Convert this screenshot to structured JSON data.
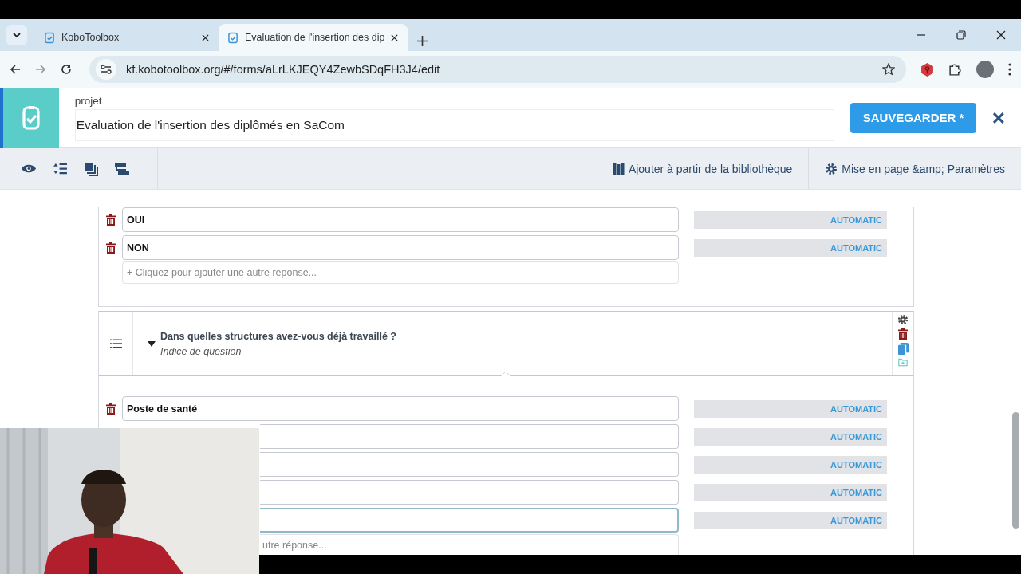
{
  "browser": {
    "tabs": [
      {
        "title": "KoboToolbox",
        "selected": false
      },
      {
        "title": "Evaluation de l'insertion des dip",
        "selected": true
      }
    ],
    "url": "kf.kobotoolbox.org/#/forms/aLrLKJEQY4ZewbSDqFH3J4/edit"
  },
  "header": {
    "label": "projet",
    "title": "Evaluation de l'insertion des diplômés en SaCom",
    "save_button": "SAUVEGARDER *"
  },
  "toolbar": {
    "library_button": "Ajouter à partir de la bibliothèque",
    "settings_button": "Mise en page &amp; Paramètres"
  },
  "questions": [
    {
      "options": [
        {
          "label": "OUI",
          "value": "AUTOMATIC",
          "focused": false
        },
        {
          "label": "NON",
          "value": "AUTOMATIC",
          "focused": false
        }
      ],
      "add_option": "+ Cliquez pour ajouter une autre réponse..."
    },
    {
      "title": "Dans quelles structures avez-vous déjà travaillé ?",
      "hint": "Indice de question",
      "expanded": true,
      "options": [
        {
          "label": "Poste de santé",
          "value": "AUTOMATIC",
          "focused": false
        },
        {
          "value": "AUTOMATIC",
          "focused": false
        },
        {
          "value": "AUTOMATIC",
          "focused": false
        },
        {
          "value": "AUTOMATIC",
          "focused": false
        },
        {
          "value": "AUTOMATIC",
          "focused": true
        }
      ],
      "add_option": "utre réponse..."
    }
  ]
}
